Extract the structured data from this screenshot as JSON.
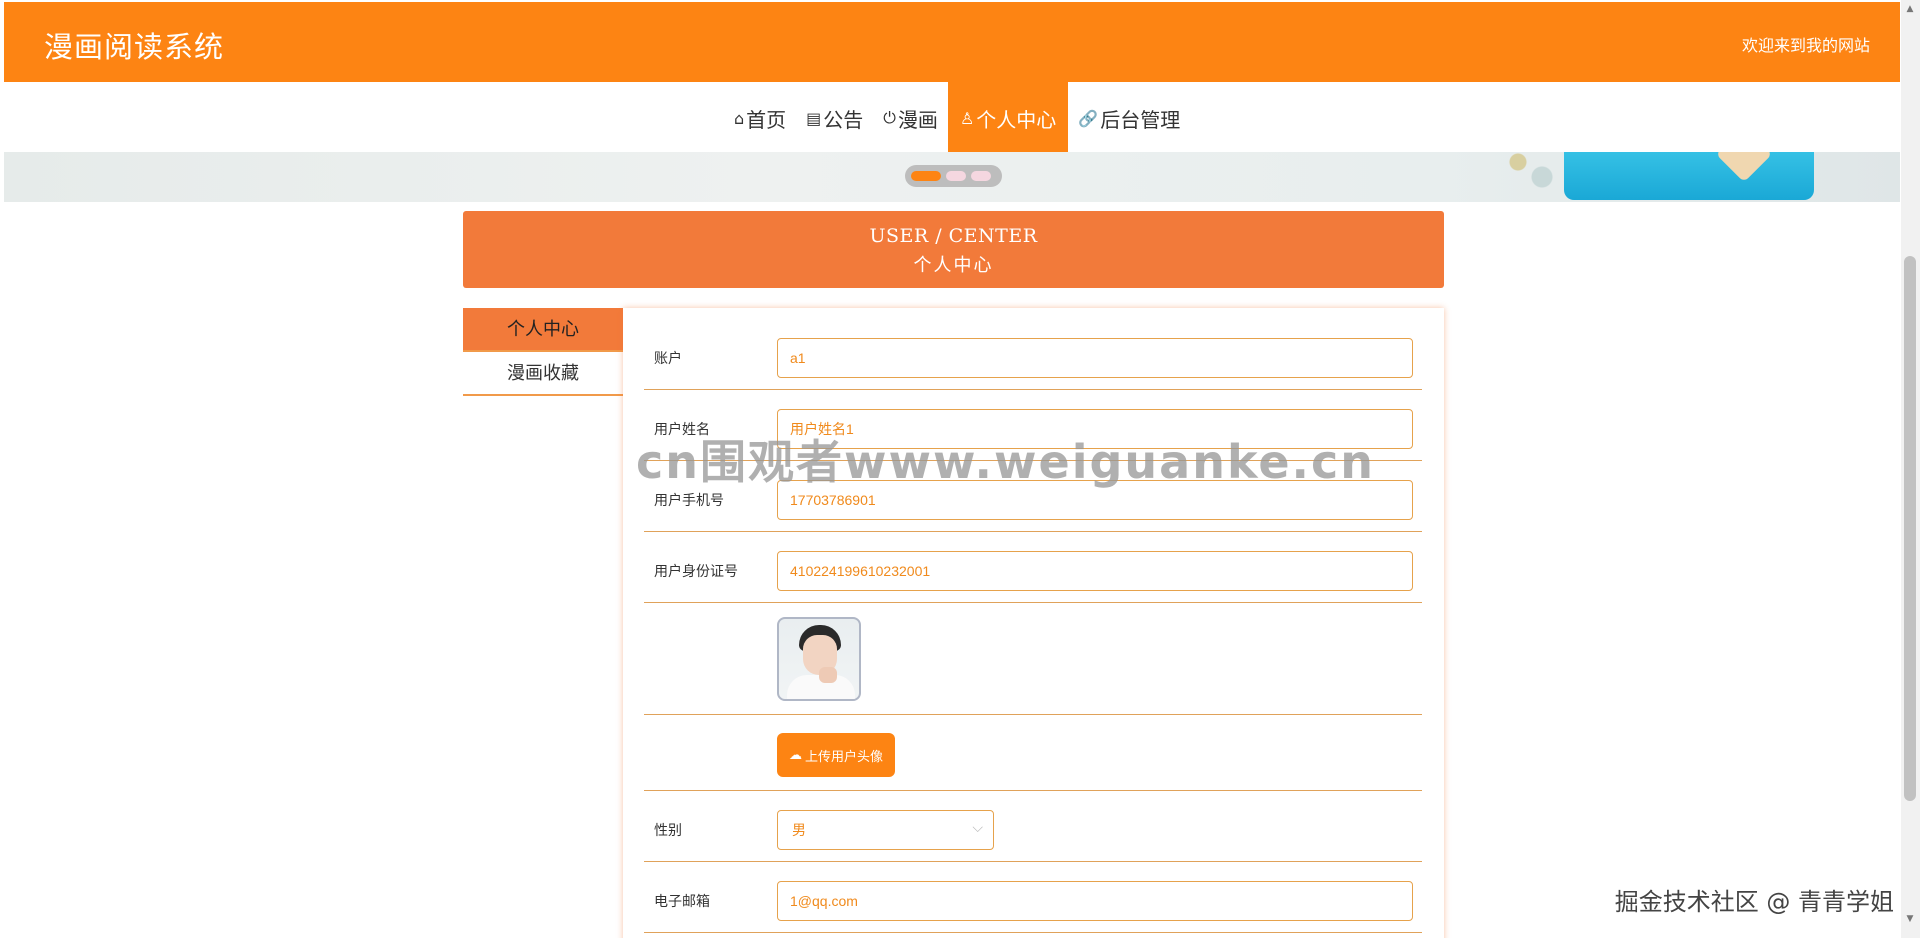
{
  "header": {
    "site_title": "漫画阅读系统",
    "welcome": "欢迎来到我的网站"
  },
  "nav": {
    "items": [
      {
        "icon": "⌂",
        "label": "首页"
      },
      {
        "icon": "▤",
        "label": "公告"
      },
      {
        "icon": "⏻",
        "label": "漫画"
      },
      {
        "icon": "♙",
        "label": "个人中心"
      },
      {
        "icon": "🔗",
        "label": "后台管理"
      }
    ],
    "active_index": 3
  },
  "section": {
    "title_en": "USER / CENTER",
    "title_cn": "个人中心"
  },
  "side_menu": {
    "items": [
      "个人中心",
      "漫画收藏"
    ]
  },
  "form": {
    "account_label": "账户",
    "account_value": "a1",
    "name_label": "用户姓名",
    "name_value": "用户姓名1",
    "phone_label": "用户手机号",
    "phone_value": "17703786901",
    "idcard_label": "用户身份证号",
    "idcard_value": "410224199610232001",
    "upload_label": "上传用户头像",
    "gender_label": "性别",
    "gender_value": "男",
    "email_label": "电子邮箱",
    "email_value": "1@qq.com"
  },
  "overlays": {
    "watermark": "cn围观者www.weiguanke.cn",
    "corner_mark": "掘金技术社区 @ 青青学姐"
  },
  "colors": {
    "brand": "#fd8413",
    "section": "#f27a3a"
  }
}
